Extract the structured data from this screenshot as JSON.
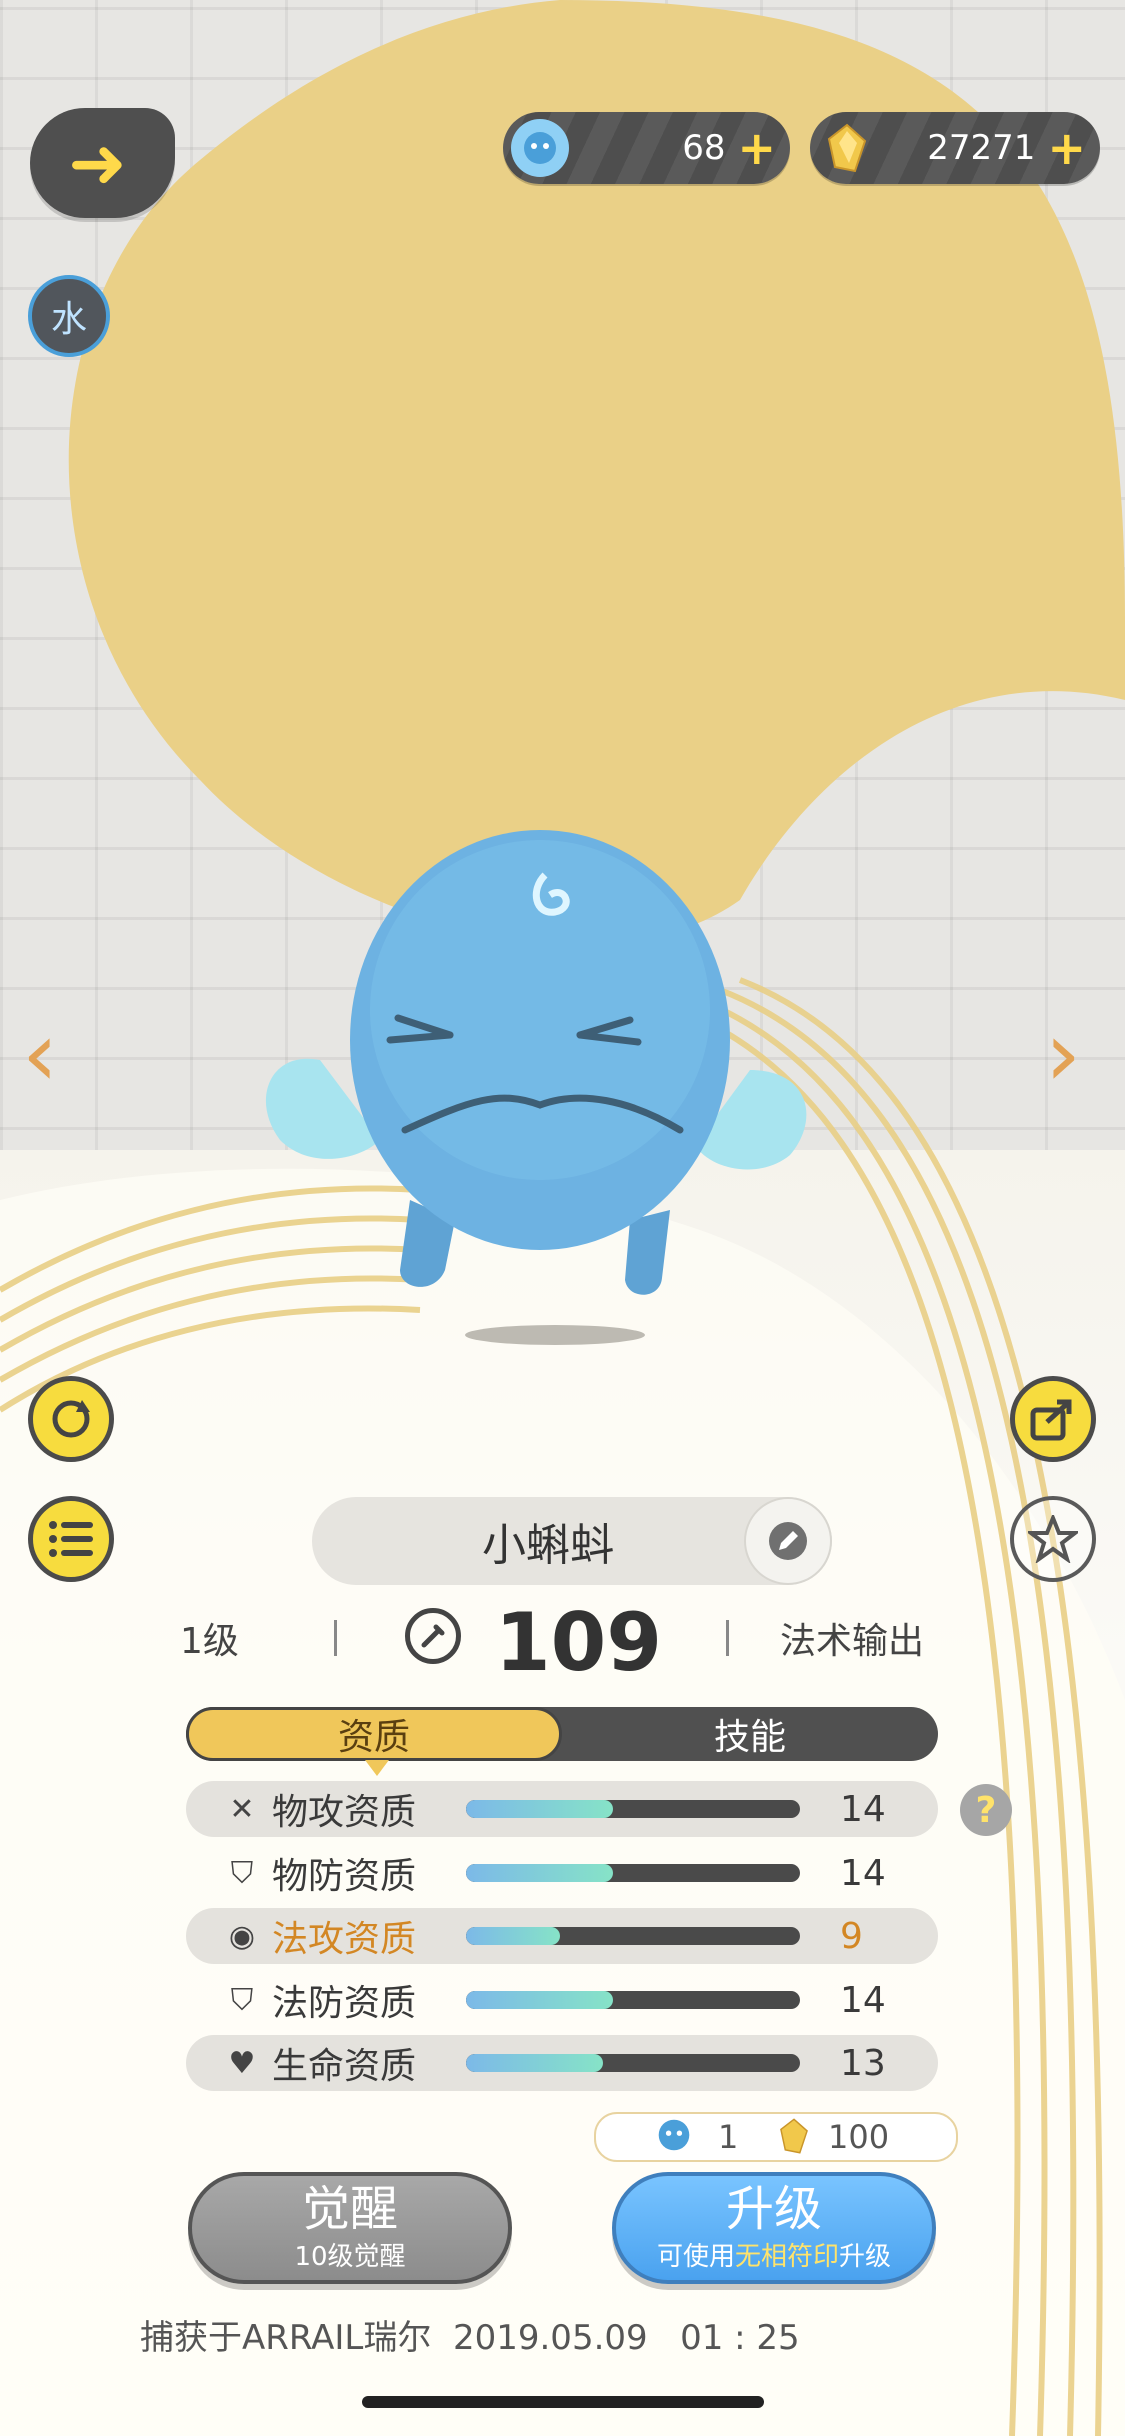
{
  "topbar": {
    "back_icon": "arrow-left-icon",
    "element": "水",
    "currency_1": {
      "icon": "pet-orb-icon",
      "value": "68",
      "plus": "+"
    },
    "currency_2": {
      "icon": "gold-crystal-icon",
      "value": "27271",
      "plus": "+"
    }
  },
  "navigation": {
    "prev": "‹",
    "next": "›"
  },
  "side_buttons": {
    "left": [
      "refresh-icon",
      "list-icon"
    ],
    "right": [
      "share-icon",
      "star-icon"
    ]
  },
  "pet": {
    "name": "小蝌蚪",
    "level": "1级",
    "power": "109",
    "role": "法术输出"
  },
  "tabs": [
    {
      "label": "资质",
      "active": true
    },
    {
      "label": "技能",
      "active": false
    }
  ],
  "attributes": [
    {
      "icon": "swords-icon",
      "label": "物攻资质",
      "value": "14",
      "fraction": 0.44,
      "highlight": false
    },
    {
      "icon": "shield-icon",
      "label": "物防资质",
      "value": "14",
      "fraction": 0.44,
      "highlight": false
    },
    {
      "icon": "magic-swirl-icon",
      "label": "法攻资质",
      "value": "9",
      "fraction": 0.28,
      "highlight": true
    },
    {
      "icon": "magic-shield-icon",
      "label": "法防资质",
      "value": "14",
      "fraction": 0.44,
      "highlight": false
    },
    {
      "icon": "heart-icon",
      "label": "生命资质",
      "value": "13",
      "fraction": 0.41,
      "highlight": false
    }
  ],
  "help": "?",
  "cost": {
    "orb": "1",
    "gold": "100"
  },
  "buttons": {
    "awaken": {
      "title": "觉醒",
      "subtitle": "10级觉醒"
    },
    "upgrade": {
      "title": "升级",
      "sub_prefix": "可使用",
      "sub_highlight": "无相符印",
      "sub_suffix": "升级"
    }
  },
  "capture_text": "捕获于ARRAIL瑞尔  2019.05.09   01 : 25",
  "colors": {
    "gold_swirl": "#e9cd7c",
    "accent_orange": "#d38724",
    "upgrade_blue": "#4aa2ef"
  }
}
